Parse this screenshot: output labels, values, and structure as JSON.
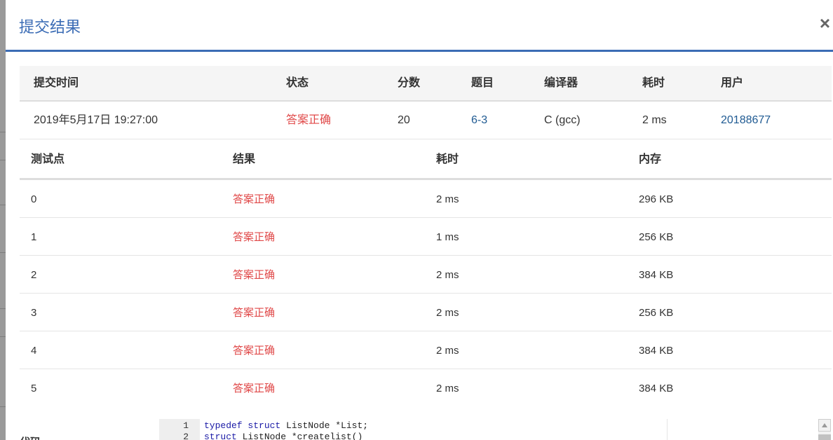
{
  "modal": {
    "title": "提交结果",
    "close": "×"
  },
  "summary": {
    "headers": [
      "提交时间",
      "状态",
      "分数",
      "题目",
      "编译器",
      "耗时",
      "用户"
    ],
    "row": {
      "time": "2019年5月17日 19:27:00",
      "status": "答案正确",
      "score": "20",
      "problem": "6-3",
      "compiler": "C (gcc)",
      "duration": "2 ms",
      "user": "20188677"
    }
  },
  "cases": {
    "headers": [
      "测试点",
      "结果",
      "耗时",
      "内存"
    ],
    "rows": [
      {
        "id": "0",
        "result": "答案正确",
        "time": "2 ms",
        "memory": "296 KB"
      },
      {
        "id": "1",
        "result": "答案正确",
        "time": "1 ms",
        "memory": "256 KB"
      },
      {
        "id": "2",
        "result": "答案正确",
        "time": "2 ms",
        "memory": "384 KB"
      },
      {
        "id": "3",
        "result": "答案正确",
        "time": "2 ms",
        "memory": "256 KB"
      },
      {
        "id": "4",
        "result": "答案正确",
        "time": "2 ms",
        "memory": "384 KB"
      },
      {
        "id": "5",
        "result": "答案正确",
        "time": "2 ms",
        "memory": "384 KB"
      }
    ]
  },
  "code": {
    "label": "代码",
    "lines": [
      {
        "num": "1",
        "kw1": "typedef",
        "kw2": "struct",
        "rest": " ListNode *List;"
      },
      {
        "num": "2",
        "kw1": "struct",
        "kw2": "",
        "rest": " ListNode *createlist()"
      }
    ]
  },
  "colors": {
    "accent": "#3b6cb5",
    "success": "#e04848",
    "link": "#1f5a92"
  }
}
